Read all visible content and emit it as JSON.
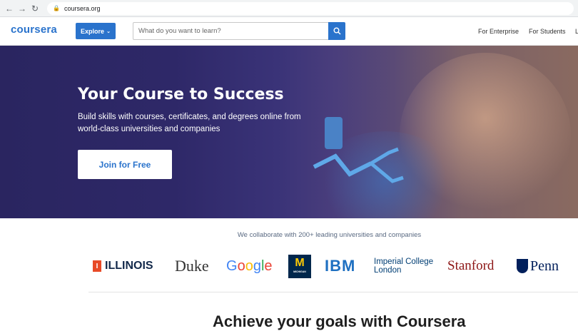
{
  "browser": {
    "url": "coursera.org"
  },
  "header": {
    "logo": "coursera",
    "explore_label": "Explore",
    "search_placeholder": "What do you want to learn?",
    "nav": [
      "For Enterprise",
      "For Students",
      "L"
    ]
  },
  "hero": {
    "title": "Your Course to Success",
    "subtitle": "Build skills with courses, certificates, and degrees online from world-class universities and companies",
    "cta": "Join for Free"
  },
  "partners": {
    "heading": "We collaborate with 200+ leading universities and companies",
    "logos": [
      "ILLINOIS",
      "Duke",
      "Google",
      "MICHIGAN",
      "IBM",
      "Imperial College London",
      "Stanford",
      "Penn"
    ]
  },
  "section": {
    "heading": "Achieve your goals with Coursera"
  },
  "colors": {
    "brand": "#2a73cc"
  }
}
